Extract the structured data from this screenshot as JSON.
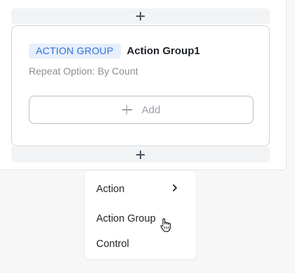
{
  "insert_top": {
    "icon": "plus-icon"
  },
  "group": {
    "badge": "ACTION GROUP",
    "title": "Action Group1",
    "repeat_option": "Repeat Option: By Count",
    "add_button": {
      "label": "Add",
      "icon": "plus-icon"
    }
  },
  "insert_bottom": {
    "icon": "plus-icon"
  },
  "menu": {
    "items": [
      {
        "label": "Action",
        "icon": "chevron-right-icon"
      },
      {
        "label": "Action Group"
      },
      {
        "label": "Control"
      }
    ]
  },
  "colors": {
    "badge_bg": "#e6effb",
    "badge_text": "#2f6fd6",
    "card_border": "#cfd3d8",
    "muted_text": "#8a8f96"
  }
}
